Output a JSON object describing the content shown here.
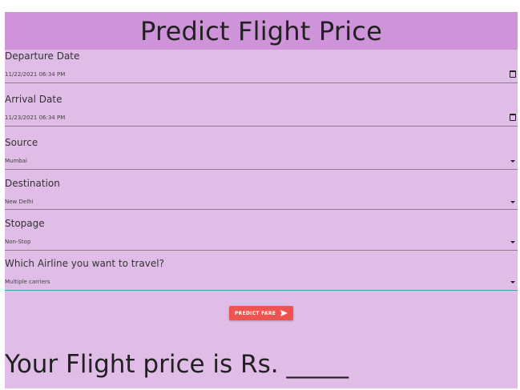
{
  "header": {
    "title": "Predict Flight Price"
  },
  "form": {
    "departure": {
      "label": "Departure Date",
      "value": "11/22/2021 06:34 PM"
    },
    "arrival": {
      "label": "Arrival Date",
      "value": "11/23/2021 06:34 PM"
    },
    "source": {
      "label": "Source",
      "value": "Mumbai"
    },
    "destination": {
      "label": "Destination",
      "value": "New Delhi"
    },
    "stopage": {
      "label": "Stopage",
      "value": "Non-Stop"
    },
    "airline": {
      "label": "Which Airline you want to travel?",
      "value": "Multiple carriers"
    }
  },
  "button": {
    "label": "PREDICT FARE",
    "icon": "send-icon"
  },
  "result": {
    "text": "Your Flight price is Rs. _____"
  },
  "colors": {
    "header_bg": "#ce93d8",
    "panel_bg": "#e0bde6",
    "button_bg": "#ef5350",
    "focus_line": "#3aa5a0"
  }
}
